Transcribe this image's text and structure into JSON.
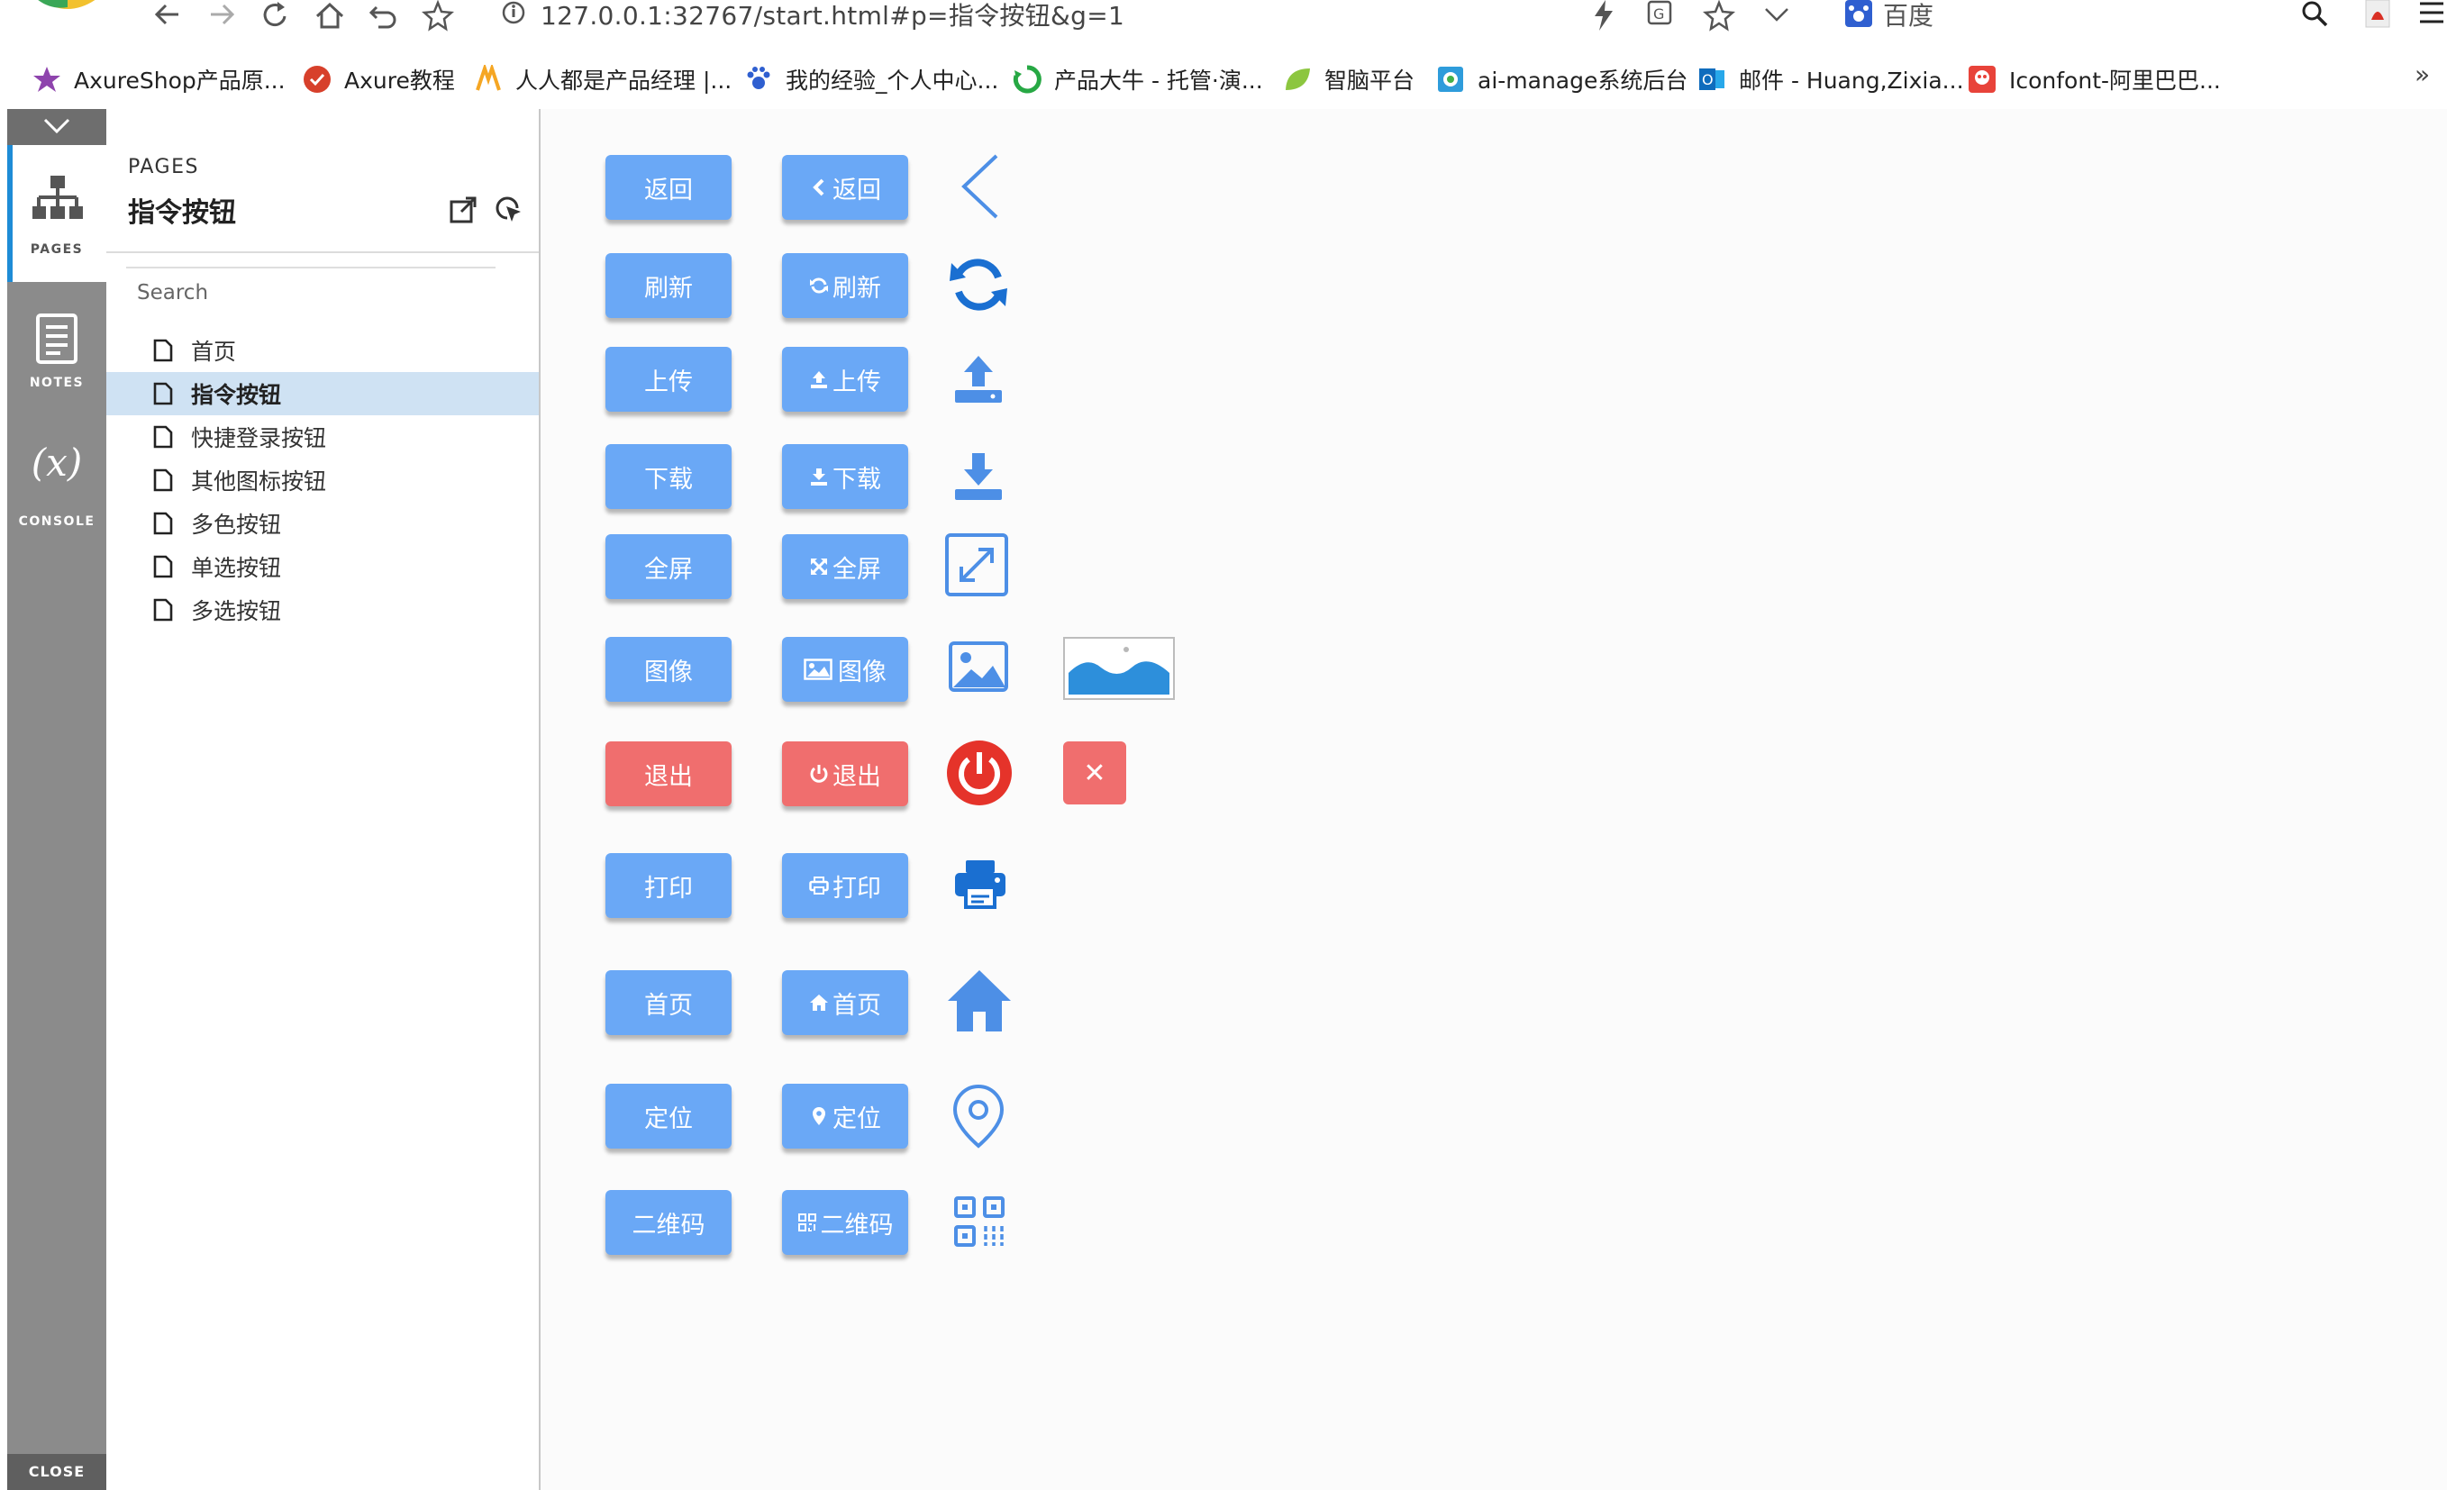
{
  "browser": {
    "url": "127.0.0.1:32767/start.html#p=指令按钮&g=1",
    "search_engine": "百度",
    "bookmarks": [
      {
        "label": "AxureShop产品原...",
        "icon": "axureshop-icon"
      },
      {
        "label": "Axure教程",
        "icon": "axure-tutorial-icon"
      },
      {
        "label": "人人都是产品经理 |...",
        "icon": "woshipm-icon"
      },
      {
        "label": "我的经验_个人中心...",
        "icon": "baidu-paw-icon"
      },
      {
        "label": "产品大牛 - 托管·演...",
        "icon": "pmdaniu-icon"
      },
      {
        "label": "智脑平台",
        "icon": "leaf-icon"
      },
      {
        "label": "ai-manage系统后台",
        "icon": "ai-manage-icon"
      },
      {
        "label": "邮件 - Huang,Zixia...",
        "icon": "outlook-icon"
      },
      {
        "label": "Iconfont-阿里巴巴...",
        "icon": "iconfont-icon"
      }
    ],
    "more": "»"
  },
  "rail": {
    "pages_label": "PAGES",
    "notes_label": "NOTES",
    "console_label": "CONSOLE",
    "console_glyph": "(x)",
    "close_label": "CLOSE"
  },
  "panel": {
    "section_label": "PAGES",
    "current_page_title": "指令按钮",
    "search_placeholder": "Search",
    "pages": [
      {
        "label": "首页",
        "active": false
      },
      {
        "label": "指令按钮",
        "active": true
      },
      {
        "label": "快捷登录按钮",
        "active": false
      },
      {
        "label": "其他图标按钮",
        "active": false
      },
      {
        "label": "多色按钮",
        "active": false
      },
      {
        "label": "单选按钮",
        "active": false
      },
      {
        "label": "多选按钮",
        "active": false
      }
    ]
  },
  "colors": {
    "button_blue": "#6aa8f6",
    "button_red": "#f06e6e",
    "icon_blue": "#4d8fe6",
    "icon_dark_blue": "#1a6fd1",
    "power_red": "#e5332a",
    "rail_accent": "#1e8cd6",
    "active_row": "#cfe2f3"
  },
  "rows": [
    {
      "label": "返回",
      "icon_button_label": "返回",
      "icon": "chevron-left-icon",
      "variant": "blue"
    },
    {
      "label": "刷新",
      "icon_button_label": "刷新",
      "icon": "refresh-icon",
      "variant": "blue"
    },
    {
      "label": "上传",
      "icon_button_label": "上传",
      "icon": "upload-icon",
      "variant": "blue"
    },
    {
      "label": "下载",
      "icon_button_label": "下载",
      "icon": "download-icon",
      "variant": "blue"
    },
    {
      "label": "全屏",
      "icon_button_label": "全屏",
      "icon": "fullscreen-icon",
      "variant": "blue"
    },
    {
      "label": "图像",
      "icon_button_label": "图像",
      "icon": "image-icon",
      "variant": "blue"
    },
    {
      "label": "退出",
      "icon_button_label": "退出",
      "icon": "power-icon",
      "variant": "red"
    },
    {
      "label": "打印",
      "icon_button_label": "打印",
      "icon": "print-icon",
      "variant": "blue"
    },
    {
      "label": "首页",
      "icon_button_label": "首页",
      "icon": "home-icon",
      "variant": "blue"
    },
    {
      "label": "定位",
      "icon_button_label": "定位",
      "icon": "location-icon",
      "variant": "blue"
    },
    {
      "label": "二维码",
      "icon_button_label": "二维码",
      "icon": "qrcode-icon",
      "variant": "blue"
    }
  ],
  "extras": {
    "image_placeholder_icon": "landscape-placeholder-icon",
    "close_button_icon": "close-icon",
    "close_glyph": "✕"
  }
}
